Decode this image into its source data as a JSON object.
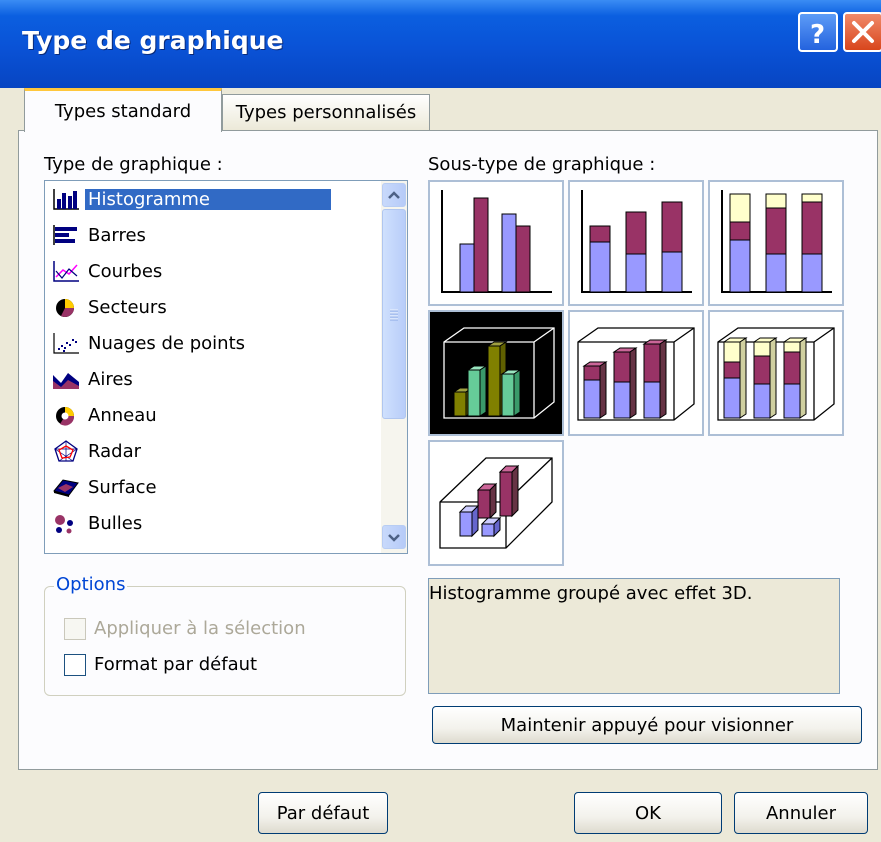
{
  "window": {
    "title": "Type de graphique"
  },
  "tabs": [
    {
      "label": "Types standard",
      "active": true
    },
    {
      "label": "Types personnalisés",
      "active": false
    }
  ],
  "chart_type": {
    "label": "Type de graphique :",
    "items": [
      {
        "label": "Histogramme",
        "icon": "column-chart-icon",
        "selected": true
      },
      {
        "label": "Barres",
        "icon": "bar-chart-icon",
        "selected": false
      },
      {
        "label": "Courbes",
        "icon": "line-chart-icon",
        "selected": false
      },
      {
        "label": "Secteurs",
        "icon": "pie-chart-icon",
        "selected": false
      },
      {
        "label": "Nuages de points",
        "icon": "scatter-chart-icon",
        "selected": false
      },
      {
        "label": "Aires",
        "icon": "area-chart-icon",
        "selected": false
      },
      {
        "label": "Anneau",
        "icon": "doughnut-chart-icon",
        "selected": false
      },
      {
        "label": "Radar",
        "icon": "radar-chart-icon",
        "selected": false
      },
      {
        "label": "Surface",
        "icon": "surface-chart-icon",
        "selected": false
      },
      {
        "label": "Bulles",
        "icon": "bubble-chart-icon",
        "selected": false
      }
    ]
  },
  "subtype": {
    "label": "Sous-type de graphique :",
    "selected_index": 3,
    "description": "Histogramme groupé avec effet 3D."
  },
  "options": {
    "legend": "Options",
    "apply_to_selection": {
      "label": "Appliquer à la sélection",
      "checked": false,
      "enabled": false
    },
    "default_format": {
      "label": "Format par défaut",
      "checked": false,
      "enabled": true
    }
  },
  "buttons": {
    "preview": "Maintenir appuyé pour visionner",
    "default": "Par défaut",
    "ok": "OK",
    "cancel": "Annuler"
  },
  "colors": {
    "periwinkle": "#9999ff",
    "plum": "#993366",
    "light_yellow": "#ffffcc",
    "selection": "#316ac5"
  }
}
